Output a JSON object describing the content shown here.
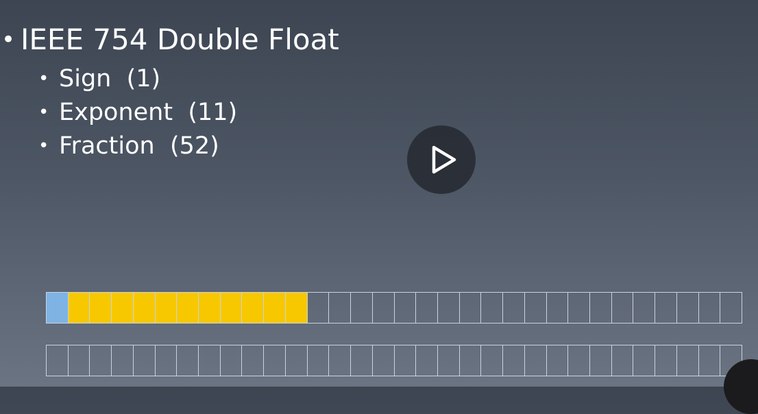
{
  "slide": {
    "title": "IEEE 754 Double Float",
    "bullet_glyph": "•",
    "items": [
      {
        "label": "Sign",
        "count": "(1)"
      },
      {
        "label": "Exponent",
        "count": "(11)"
      },
      {
        "label": "Fraction",
        "count": "(52)"
      }
    ]
  },
  "player": {
    "play_icon": "play-icon"
  },
  "bit_rows": [
    {
      "cells": 32,
      "sign_bits": 1,
      "exponent_bits": 11
    },
    {
      "cells": 32,
      "sign_bits": 0,
      "exponent_bits": 0
    }
  ],
  "colors": {
    "sign": "#7fb3e3",
    "exponent": "#f7c800",
    "cell_border": "#c9d4e0"
  }
}
